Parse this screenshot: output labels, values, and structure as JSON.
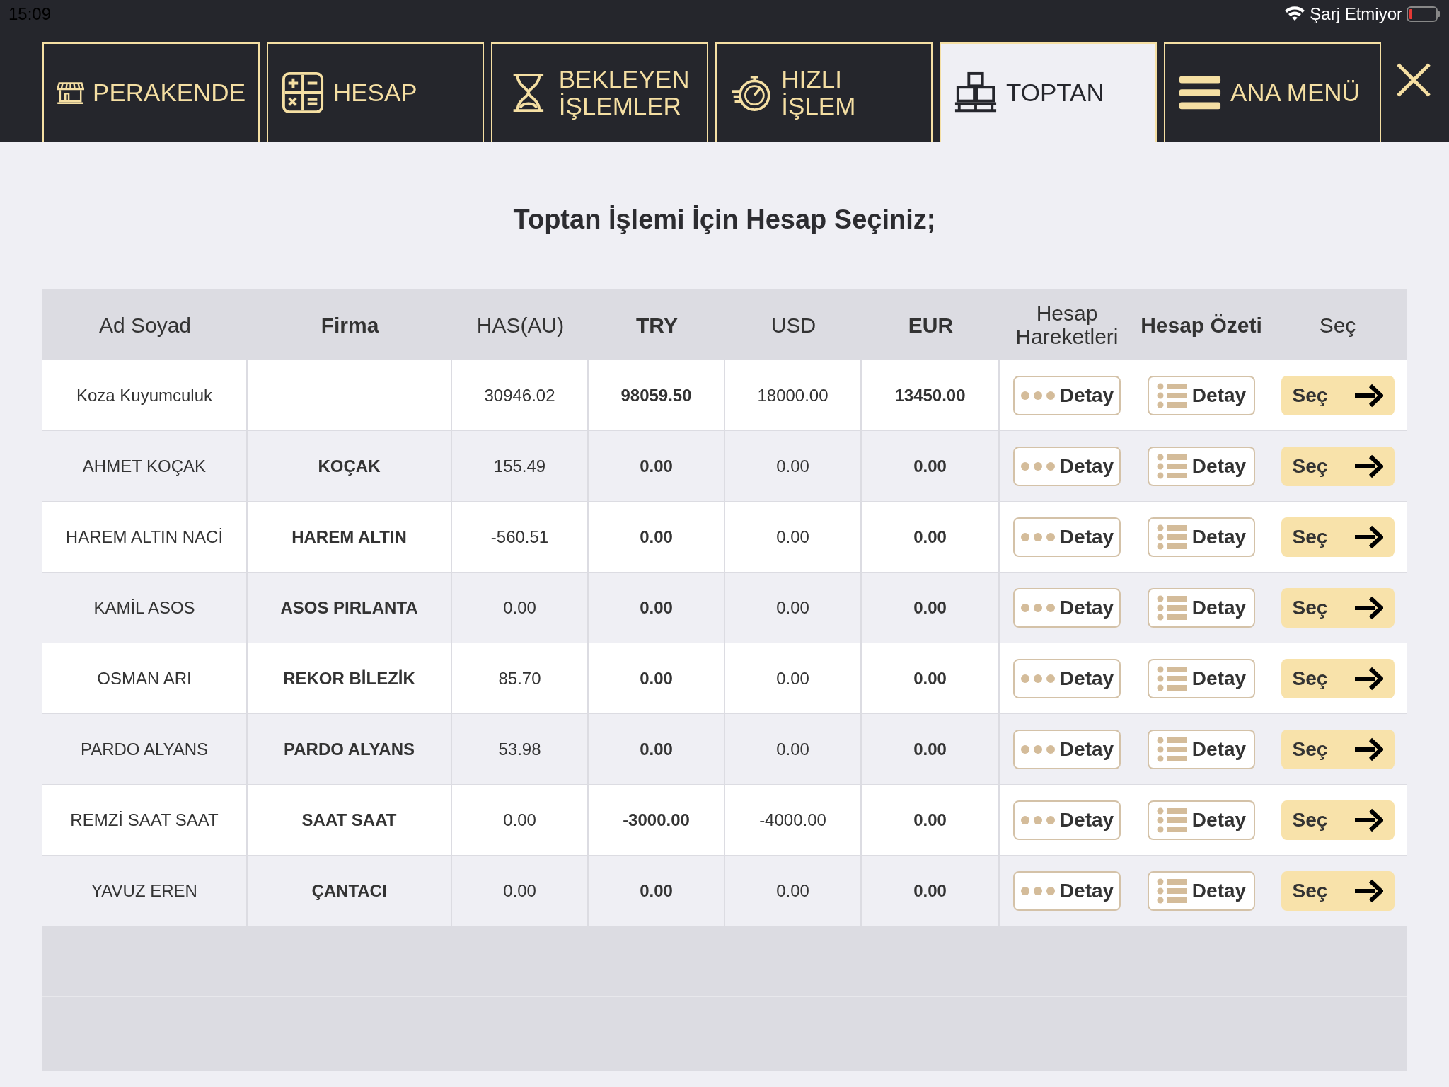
{
  "status_bar": {
    "time": "15:09",
    "charging": "Şarj Etmiyor"
  },
  "tabs": [
    {
      "label": "PERAKENDE",
      "selected": false
    },
    {
      "label": "HESAP",
      "selected": false
    },
    {
      "label": "BEKLEYEN İŞLEMLER",
      "selected": false
    },
    {
      "label": "HIZLI İŞLEM",
      "selected": false
    },
    {
      "label": "TOPTAN",
      "selected": true
    },
    {
      "label": "ANA MENÜ",
      "selected": false
    }
  ],
  "title": "Toptan İşlemi İçin Hesap Seçiniz;",
  "table": {
    "columns": [
      {
        "label": "Ad Soyad",
        "kind": "plain"
      },
      {
        "label": "Firma",
        "kind": "strong"
      },
      {
        "label": "HAS(AU)",
        "kind": "plain"
      },
      {
        "label": "TRY",
        "kind": "strong"
      },
      {
        "label": "USD",
        "kind": "plain"
      },
      {
        "label": "EUR",
        "kind": "strong"
      },
      {
        "label": "Hesap Hareketleri",
        "kind": "plain"
      },
      {
        "label": "Hesap Özeti",
        "kind": "strong"
      },
      {
        "label": "Seç",
        "kind": "plain"
      }
    ],
    "rows": [
      {
        "cells": [
          "Koza Kuyumculuk",
          "",
          "30946.02",
          "98059.50",
          "18000.00",
          "13450.00"
        ],
        "buttons": [
          "Detay",
          "Detay",
          "Seç"
        ]
      },
      {
        "cells": [
          "AHMET KOÇAK",
          "KOÇAK",
          "155.49",
          "0.00",
          "0.00",
          "0.00"
        ],
        "buttons": [
          "Detay",
          "Detay",
          "Seç"
        ]
      },
      {
        "cells": [
          "HAREM ALTIN NACİ",
          "HAREM ALTIN",
          "-560.51",
          "0.00",
          "0.00",
          "0.00"
        ],
        "buttons": [
          "Detay",
          "Detay",
          "Seç"
        ]
      },
      {
        "cells": [
          "KAMİL ASOS",
          "ASOS PIRLANTA",
          "0.00",
          "0.00",
          "0.00",
          "0.00"
        ],
        "buttons": [
          "Detay",
          "Detay",
          "Seç"
        ]
      },
      {
        "cells": [
          "OSMAN ARI",
          "REKOR BİLEZİK",
          "85.70",
          "0.00",
          "0.00",
          "0.00"
        ],
        "buttons": [
          "Detay",
          "Detay",
          "Seç"
        ]
      },
      {
        "cells": [
          "PARDO ALYANS",
          "PARDO ALYANS",
          "53.98",
          "0.00",
          "0.00",
          "0.00"
        ],
        "buttons": [
          "Detay",
          "Detay",
          "Seç"
        ]
      },
      {
        "cells": [
          "REMZİ SAAT SAAT",
          "SAAT SAAT",
          "0.00",
          "-3000.00",
          "-4000.00",
          "0.00"
        ],
        "buttons": [
          "Detay",
          "Detay",
          "Seç"
        ]
      },
      {
        "cells": [
          "YAVUZ EREN",
          "ÇANTACI",
          "0.00",
          "0.00",
          "0.00",
          "0.00"
        ],
        "buttons": [
          "Detay",
          "Detay",
          "Seç"
        ]
      }
    ]
  }
}
